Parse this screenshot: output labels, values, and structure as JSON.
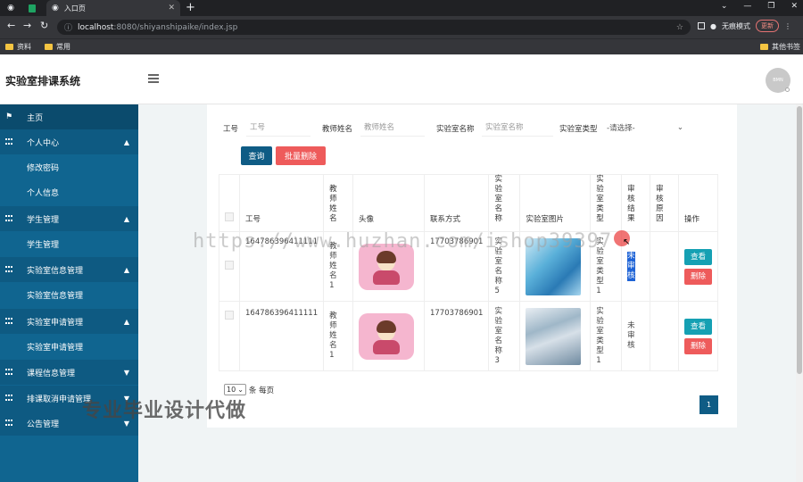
{
  "browser": {
    "tab_title": "入口页",
    "url_host": "localhost",
    "url_path": ":8080/shiyanshipaike/index.jsp",
    "incognito_label": "无痕模式",
    "update_label": "更新",
    "bookmarks": [
      "资料",
      "常用"
    ],
    "other_bookmarks": "其他书签"
  },
  "app": {
    "title": "实验室排课系统",
    "avatar_text": "BMN"
  },
  "sidebar": {
    "home": "主页",
    "items": [
      {
        "label": "个人中心",
        "type": "group"
      },
      {
        "label": "修改密码",
        "type": "sub"
      },
      {
        "label": "个人信息",
        "type": "sub"
      },
      {
        "label": "学生管理",
        "type": "group"
      },
      {
        "label": "学生管理",
        "type": "sub"
      },
      {
        "label": "实验室信息管理",
        "type": "group"
      },
      {
        "label": "实验室信息管理",
        "type": "sub"
      },
      {
        "label": "实验室申请管理",
        "type": "group"
      },
      {
        "label": "实验室申请管理",
        "type": "sub"
      },
      {
        "label": "课程信息管理",
        "type": "group"
      },
      {
        "label": "排课取消申请管理",
        "type": "group"
      },
      {
        "label": "公告管理",
        "type": "group"
      }
    ]
  },
  "search": {
    "gonghao_label": "工号",
    "gonghao_placeholder": "工号",
    "teacher_label": "教师姓名",
    "teacher_placeholder": "教师姓名",
    "lab_name_label": "实验室名称",
    "lab_name_placeholder": "实验室名称",
    "lab_type_label": "实验室类型",
    "lab_type_value": "-请选择-",
    "query_button": "查询",
    "batch_delete_button": "批量删除"
  },
  "table": {
    "headers": [
      "工号",
      "教师姓名",
      "头像",
      "联系方式",
      "实验室名称",
      "实验室图片",
      "实验室类型",
      "审核结果",
      "审核原因",
      "操作"
    ],
    "rows": [
      {
        "gonghao": "164786396411111",
        "teacher": "教师姓名1",
        "phone": "17703786901",
        "lab_name": "实验室名称5",
        "lab_type": "实验室类型1",
        "audit": "未审核",
        "reason": ""
      },
      {
        "gonghao": "164786396411111",
        "teacher": "教师姓名1",
        "phone": "17703786901",
        "lab_name": "实验室名称3",
        "lab_type": "实验室类型1",
        "audit": "未审核",
        "reason": ""
      }
    ],
    "view_label": "查看",
    "delete_label": "删除"
  },
  "pagination": {
    "page_size": "10",
    "per_page_label": "条 每页",
    "current_page": "1"
  },
  "watermarks": {
    "url": "https://www.huzhan.com/ishop39397",
    "cn": "专业毕业设计代做"
  },
  "colors": {
    "sidebar": "#106590",
    "primary": "#0f5c85",
    "danger": "#ee5b5b",
    "info": "#15a0b3"
  }
}
